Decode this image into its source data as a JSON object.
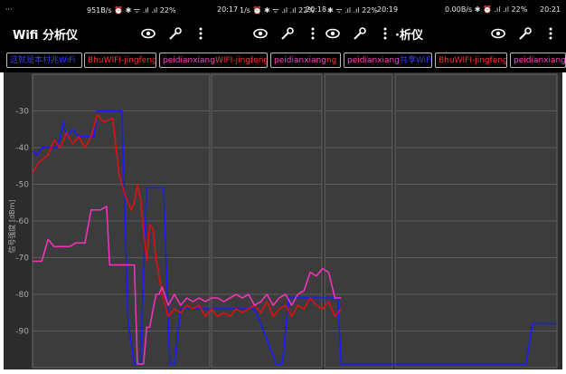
{
  "status_bar": {
    "left_dots": "···",
    "segments": [
      {
        "text": "951B/s ⏰ ✱ ᯤ .ıl .ıl 22%",
        "time": "20:17"
      },
      {
        "text": "1/s ⏰ ✱ ᯤ .ıl .ıl 22%",
        "time": "20:18"
      },
      {
        "text": "✱ ᯤ .ıl .ıl 22%",
        "time": "20:19"
      },
      {
        "text": "0.00B/s ✱ ⏰ .ıl .ıl 22%",
        "time": "20:21"
      }
    ]
  },
  "app_bar": {
    "title": "Wifi 分析仪",
    "title_partial": "·析仪",
    "icons": [
      "eye-icon",
      "wrench-icon",
      "more-icon"
    ]
  },
  "tabs": [
    {
      "label": "这就是本村兆WiFi",
      "color": "#3a3aff"
    },
    {
      "label": "BhuWIFI-jingfeng",
      "color": "#ff3333"
    },
    {
      "label": "peidianxiang",
      "label_b": "WIFI-jingfeng",
      "color": "#ff44cc",
      "color_b": "#ff3333"
    },
    {
      "label": "peidianxiang",
      "label_b": "ng",
      "color": "#ff44cc",
      "color_b": "#ff3333"
    },
    {
      "label": "peidianxiang",
      "label_b": "共享WiFi",
      "color": "#ff44cc",
      "color_b": "#3a3aff"
    },
    {
      "label": "BhuWIFI-jingfeng",
      "color": "#ff3333"
    },
    {
      "label": "peidianxiang",
      "color": "#ff44cc"
    }
  ],
  "colors": {
    "blue": "#1a1aff",
    "red": "#dd1111",
    "magenta": "#ee33bb",
    "plot_bg": "#3c3c3c",
    "grid": "#5a5a5a"
  },
  "chart_data": {
    "type": "line",
    "ylabel": "信号强度 [dBm]",
    "ylim": [
      -100,
      -20
    ],
    "yticks": [
      -30,
      -40,
      -50,
      -60,
      -70,
      -80,
      -90
    ],
    "grid": true,
    "xlim": [
      0,
      100
    ],
    "series": [
      {
        "name": "这就是本村兆WiFi",
        "color": "#1a1aff",
        "points": [
          [
            0,
            -41
          ],
          [
            1.5,
            -42
          ],
          [
            3,
            -40
          ],
          [
            8,
            -40
          ],
          [
            10,
            -33
          ],
          [
            11,
            -37
          ],
          [
            13,
            -35
          ],
          [
            15,
            -37
          ],
          [
            20,
            -37
          ],
          [
            21,
            -30
          ],
          [
            29,
            -30
          ],
          [
            31,
            -88
          ],
          [
            33,
            -99
          ],
          [
            35,
            -99
          ],
          [
            37,
            -51
          ],
          [
            42,
            -51
          ],
          [
            42.5,
            -51
          ],
          [
            44.5,
            -99
          ],
          [
            46,
            -99
          ],
          [
            48,
            -84
          ],
          [
            72,
            -84
          ],
          [
            74,
            -88
          ],
          [
            79,
            -99
          ],
          [
            81,
            -99
          ],
          [
            83,
            -81
          ],
          [
            98,
            -81
          ],
          [
            99,
            -81
          ],
          [
            100,
            -99
          ],
          [
            101,
            -99
          ],
          [
            102,
            -99
          ],
          [
            115,
            -99
          ],
          [
            117,
            -99
          ],
          [
            130,
            -99
          ],
          [
            133,
            -99
          ],
          [
            140,
            -99
          ],
          [
            143,
            -99
          ],
          [
            145,
            -99
          ],
          [
            147,
            -99
          ],
          [
            148,
            -99
          ],
          [
            150,
            -99
          ],
          [
            152,
            -99
          ],
          [
            154,
            -99
          ],
          [
            156,
            -99
          ],
          [
            158,
            -99
          ],
          [
            160,
            -99
          ],
          [
            162,
            -88
          ],
          [
            170,
            -88
          ]
        ]
      },
      {
        "name": "BhuWIFI-jingfeng",
        "color": "#dd1111",
        "points": [
          [
            0,
            -47
          ],
          [
            2,
            -44
          ],
          [
            5,
            -42
          ],
          [
            7,
            -38
          ],
          [
            9,
            -40
          ],
          [
            11,
            -36
          ],
          [
            13,
            -39
          ],
          [
            15,
            -37
          ],
          [
            17,
            -40
          ],
          [
            19,
            -37
          ],
          [
            21,
            -31
          ],
          [
            23,
            -33
          ],
          [
            26,
            -32
          ],
          [
            28,
            -47
          ],
          [
            30,
            -53
          ],
          [
            32,
            -57
          ],
          [
            33,
            -55
          ],
          [
            34,
            -50
          ],
          [
            35,
            -54
          ],
          [
            37,
            -71
          ],
          [
            38,
            -61
          ],
          [
            39,
            -62
          ],
          [
            40,
            -70
          ],
          [
            41,
            -75
          ],
          [
            42,
            -80
          ],
          [
            43,
            -83
          ],
          [
            44,
            -86
          ],
          [
            46,
            -84
          ],
          [
            48,
            -85
          ],
          [
            50,
            -83
          ],
          [
            52,
            -84
          ],
          [
            54,
            -83
          ],
          [
            56,
            -86
          ],
          [
            58,
            -84
          ],
          [
            60,
            -86
          ],
          [
            62,
            -85
          ],
          [
            64,
            -86
          ],
          [
            66,
            -84
          ],
          [
            68,
            -85
          ],
          [
            70,
            -84
          ],
          [
            72,
            -83
          ],
          [
            74,
            -85
          ],
          [
            76,
            -82
          ],
          [
            78,
            -86
          ],
          [
            80,
            -84
          ],
          [
            82,
            -83
          ],
          [
            84,
            -86
          ],
          [
            86,
            -83
          ],
          [
            88,
            -84
          ],
          [
            90,
            -81
          ],
          [
            92,
            -83
          ],
          [
            94,
            -84
          ],
          [
            96,
            -82
          ],
          [
            98,
            -86
          ],
          [
            100,
            -84
          ]
        ]
      },
      {
        "name": "peidianxiang",
        "color": "#ee33bb",
        "points": [
          [
            0,
            -71
          ],
          [
            3,
            -71
          ],
          [
            5,
            -65
          ],
          [
            7,
            -67
          ],
          [
            12,
            -67
          ],
          [
            14,
            -66
          ],
          [
            17,
            -66
          ],
          [
            19,
            -57
          ],
          [
            22,
            -57
          ],
          [
            24,
            -56
          ],
          [
            25,
            -72
          ],
          [
            31,
            -72
          ],
          [
            33,
            -72
          ],
          [
            34,
            -99
          ],
          [
            36,
            -99
          ],
          [
            37,
            -89
          ],
          [
            38,
            -89
          ],
          [
            40,
            -80
          ],
          [
            41,
            -80
          ],
          [
            42,
            -78
          ],
          [
            44,
            -83
          ],
          [
            46,
            -80
          ],
          [
            48,
            -83
          ],
          [
            50,
            -81
          ],
          [
            52,
            -82
          ],
          [
            54,
            -81
          ],
          [
            56,
            -82
          ],
          [
            58,
            -81
          ],
          [
            60,
            -81
          ],
          [
            62,
            -82
          ],
          [
            64,
            -81
          ],
          [
            66,
            -80
          ],
          [
            68,
            -81
          ],
          [
            70,
            -80
          ],
          [
            72,
            -83
          ],
          [
            74,
            -82
          ],
          [
            76,
            -80
          ],
          [
            78,
            -83
          ],
          [
            80,
            -81
          ],
          [
            82,
            -80
          ],
          [
            84,
            -83
          ],
          [
            86,
            -80
          ],
          [
            88,
            -79
          ],
          [
            90,
            -74
          ],
          [
            92,
            -75
          ],
          [
            94,
            -73
          ],
          [
            96,
            -74
          ],
          [
            98,
            -81
          ],
          [
            100,
            -81
          ]
        ]
      }
    ]
  }
}
